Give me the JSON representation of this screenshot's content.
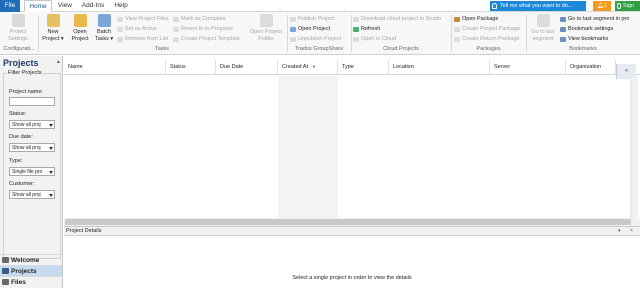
{
  "tabs": {
    "file": "File",
    "home": "Home",
    "view": "View",
    "addins": "Add-Ins",
    "help": "Help"
  },
  "tell_me": "Tell me what you want to do...",
  "notifications": "1",
  "sign_in": "Sign",
  "ribbon": {
    "configuration": {
      "project_settings_line1": "Project",
      "project_settings_line2": "Settings",
      "group": "Configurati..."
    },
    "tasks": {
      "new_project_line1": "New",
      "new_project_line2": "Project",
      "open_project_line1": "Open",
      "open_project_line2": "Project",
      "batch_tasks_line1": "Batch",
      "batch_tasks_line2": "Tasks",
      "view_project_files": "View Project Files",
      "set_as_active": "Set as Active",
      "remove_from_list": "Remove from List",
      "mark_as_complete": "Mark as Complete",
      "revert_to_in_progress": "Revert to In Progress",
      "create_project_template": "Create Project Template",
      "open_project_folder_line1": "Open Project",
      "open_project_folder_line2": "Folder",
      "group": "Tasks"
    },
    "groupshare": {
      "publish_project": "Publish Project",
      "open_project": "Open Project",
      "unpublish_project": "Unpublish Project",
      "group": "Trados GroupShare"
    },
    "cloud": {
      "download_cloud_project": "Download cloud project in Studio",
      "refresh": "Refresh",
      "open_in_cloud": "Open in Cloud",
      "group": "Cloud Projects"
    },
    "packages": {
      "open_package": "Open Package",
      "create_project_package": "Create Project Package",
      "create_return_package": "Create Return Package",
      "group": "Packages"
    },
    "bookmarks": {
      "go_to_last_segment_line1": "Go to last",
      "go_to_last_segment_line2": "segment",
      "go_to_last_segment_in_project": "Go to last segment in pro",
      "bookmark_settings": "Bookmark settings",
      "view_bookmarks": "View bookmarks",
      "group": "Bookmarks"
    }
  },
  "left_panel": {
    "title": "Projects",
    "filter_legend": "Filter Projects",
    "project_name_label": "Project name:",
    "project_name_value": "",
    "status_label": "Status:",
    "status_value": "Show all proj",
    "due_date_label": "Due date:",
    "due_date_value": "Show all proj",
    "type_label": "Type:",
    "type_value": "Single file pro",
    "customer_label": "Customer:",
    "customer_value": "Show all proj",
    "nav": {
      "welcome": "Welcome",
      "projects": "Projects",
      "files": "Files"
    }
  },
  "grid": {
    "columns": [
      "Name",
      "Status",
      "Due Date",
      "Created At",
      "Type",
      "Location",
      "Server",
      "Organization"
    ],
    "collapse_glyph": "«"
  },
  "details": {
    "title": "Project Details",
    "message": "Select a single project in order to view the details"
  },
  "colors": {
    "accent": "#1e6fb7",
    "tell_me_bg": "#1e88d8",
    "notification_bg": "#f39a1e",
    "sign_in_bg": "#2f9e44",
    "nav_active_bg": "#c6daf0"
  }
}
